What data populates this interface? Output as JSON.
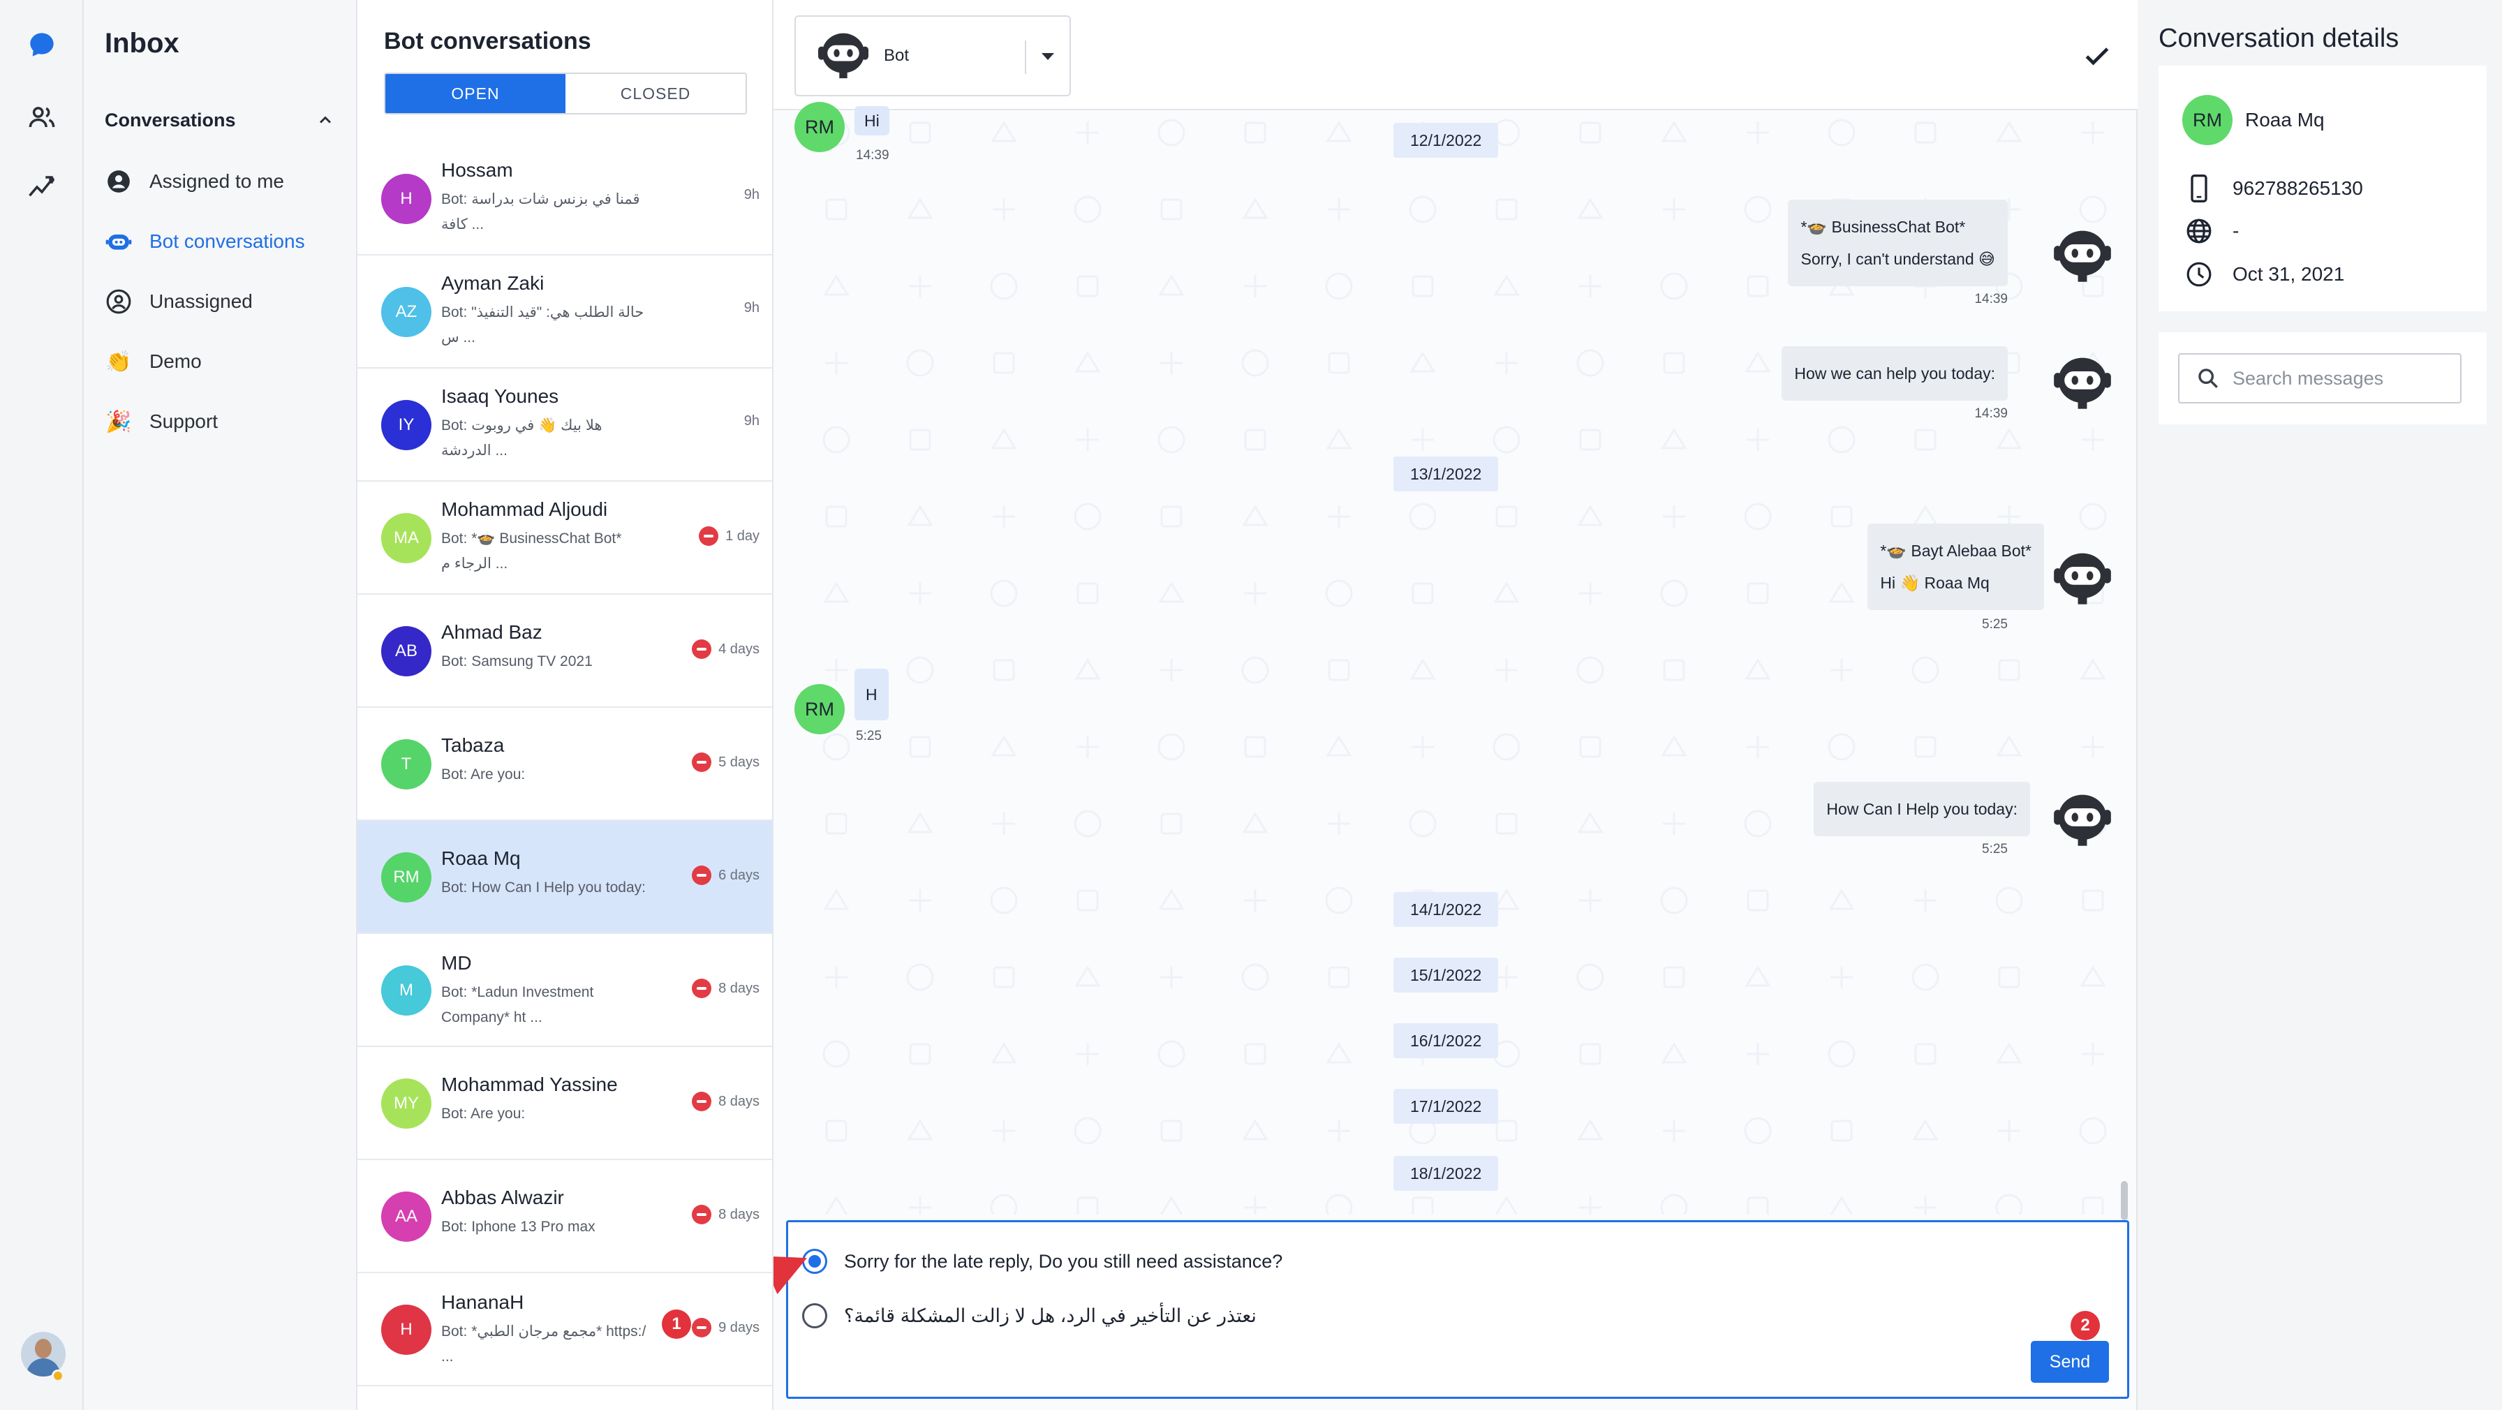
{
  "app": {
    "rail_icons": [
      "chat-bubble-icon",
      "users-icon",
      "analytics-icon"
    ],
    "accent": "#1f6fe6"
  },
  "nav": {
    "title": "Inbox",
    "section": "Conversations",
    "items": [
      {
        "label": "Assigned to me",
        "icon": "account-circle-icon"
      },
      {
        "label": "Bot conversations",
        "icon": "bot-icon"
      },
      {
        "label": "Unassigned",
        "icon": "unassigned-icon"
      },
      {
        "label": "Demo",
        "icon": "clapping-hands-icon"
      },
      {
        "label": "Support",
        "icon": "party-popper-icon"
      }
    ]
  },
  "list": {
    "title": "Bot conversations",
    "tabs": {
      "open": "OPEN",
      "closed": "CLOSED"
    },
    "rows": [
      {
        "initials": "H",
        "name": "Hossam",
        "preview": "Bot: قمنا في بزنس شات بدراسة كافة ...",
        "time": "9h",
        "overdue": false,
        "color": "#b53ac7"
      },
      {
        "initials": "AZ",
        "name": "Ayman Zaki",
        "preview": "Bot: حالة الطلب هي: \"قيد التنفيذ\" س ...",
        "time": "9h",
        "overdue": false,
        "color": "#4fc0e8"
      },
      {
        "initials": "IY",
        "name": "Isaaq Younes",
        "preview": "Bot: هلا بيك 👋 في روبوت الدردشة ...",
        "time": "9h",
        "overdue": false,
        "color": "#2b2fd6"
      },
      {
        "initials": "MA",
        "name": "Mohammad Aljoudi",
        "preview": "Bot: *🍲 BusinessChat Bot* الرجاء م ...",
        "time": "1 day",
        "overdue": true,
        "color": "#a6e35a"
      },
      {
        "initials": "AB",
        "name": "Ahmad Baz",
        "preview": "Bot: Samsung TV 2021",
        "time": "4 days",
        "overdue": true,
        "color": "#3428c9"
      },
      {
        "initials": "T",
        "name": "Tabaza",
        "preview": "Bot: Are you:",
        "time": "5 days",
        "overdue": true,
        "color": "#55d46a"
      },
      {
        "initials": "RM",
        "name": "Roaa Mq",
        "preview": "Bot: How Can I Help you today:",
        "time": "6 days",
        "overdue": true,
        "color": "#55d46a"
      },
      {
        "initials": "M",
        "name": "MD",
        "preview": "Bot: *Ladun Investment Company* ht ...",
        "time": "8 days",
        "overdue": true,
        "color": "#46c9d9"
      },
      {
        "initials": "MY",
        "name": "Mohammad Yassine",
        "preview": "Bot: Are you:",
        "time": "8 days",
        "overdue": true,
        "color": "#a6e35a"
      },
      {
        "initials": "AA",
        "name": "Abbas Alwazir",
        "preview": "Bot: Iphone 13 Pro max",
        "time": "8 days",
        "overdue": true,
        "color": "#d63fb0"
      },
      {
        "initials": "H",
        "name": "HananaH",
        "preview": "Bot: *مجمع مرجان الطبي* https:/ ...",
        "time": "9 days",
        "overdue": true,
        "color": "#df3545"
      }
    ]
  },
  "chat": {
    "agent_name": "Bot",
    "customer_initials": "RM",
    "dates": [
      "12/1/2022",
      "13/1/2022",
      "14/1/2022",
      "15/1/2022",
      "16/1/2022",
      "17/1/2022",
      "18/1/2022"
    ],
    "messages": [
      {
        "side": "in",
        "text": "Hi",
        "time": "14:39"
      },
      {
        "side": "out",
        "text": "*🍲 BusinessChat Bot*",
        "text2": "Sorry, I can't understand 😅",
        "time": "14:39"
      },
      {
        "side": "out",
        "text": "How we can help you today:",
        "time": "14:39"
      },
      {
        "side": "out",
        "text": "*🍲 Bayt Alebaa Bot*",
        "text2": "Hi 👋 Roaa Mq",
        "time": "5:25"
      },
      {
        "side": "in",
        "text": "H",
        "time": "5:25"
      },
      {
        "side": "out",
        "text": "How Can I Help you today:",
        "time": "5:25"
      }
    ],
    "composer": {
      "options": [
        "Sorry for the late reply, Do you still need assistance?",
        "نعتذر عن التأخير في الرد، هل لا زالت المشكلة قائمة؟"
      ],
      "selected": 0,
      "send_label": "Send"
    },
    "annotations": [
      "1",
      "2"
    ]
  },
  "details": {
    "title": "Conversation details",
    "initials": "RM",
    "name": "Roaa Mq",
    "phone": "962788265130",
    "website": "-",
    "date": "Oct 31, 2021",
    "search_placeholder": "Search messages"
  }
}
